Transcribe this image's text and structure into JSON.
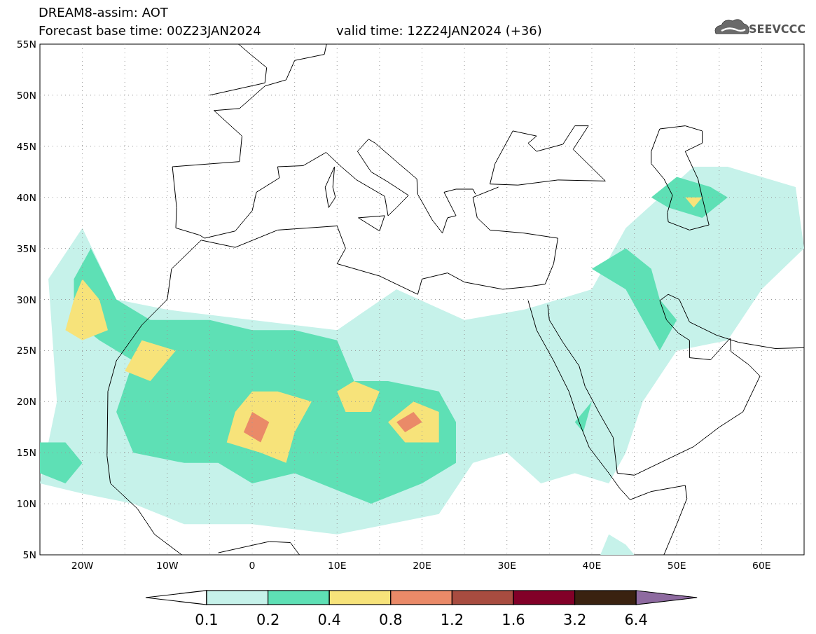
{
  "title": "DREAM8-assim: AOT",
  "subtitle": {
    "base_time": "Forecast base time: 00Z23JAN2024",
    "valid_time": "valid time: 12Z24JAN2024 (+36)"
  },
  "logo": {
    "text": "SEEVCCC"
  },
  "map": {
    "latitude_labels": [
      "55N",
      "50N",
      "45N",
      "40N",
      "35N",
      "30N",
      "25N",
      "20N",
      "15N",
      "10N",
      "5N"
    ],
    "longitude_labels": [
      "20W",
      "10W",
      "0",
      "10E",
      "20E",
      "30E",
      "40E",
      "50E",
      "60E"
    ]
  },
  "colorbar": {
    "ranges": [
      {
        "kind": "arrow-left",
        "color": "#ffffff"
      },
      {
        "kind": "box",
        "color": "#c6f2ea"
      },
      {
        "kind": "box",
        "color": "#5ee0b5"
      },
      {
        "kind": "box",
        "color": "#f7e37a"
      },
      {
        "kind": "box",
        "color": "#ea8a68"
      },
      {
        "kind": "box",
        "color": "#a84c40"
      },
      {
        "kind": "box",
        "color": "#820028"
      },
      {
        "kind": "box",
        "color": "#3a2210"
      },
      {
        "kind": "arrow-right",
        "color": "#8e6aa0"
      }
    ],
    "labels": [
      "0.1",
      "0.2",
      "0.4",
      "0.8",
      "1.2",
      "1.6",
      "3.2",
      "6.4"
    ]
  }
}
